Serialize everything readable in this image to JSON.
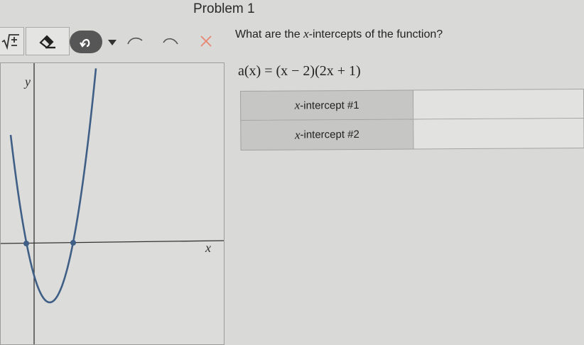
{
  "problem_title": "Problem 1",
  "toolbar": {
    "math_keyboard_icon": "sqrt-plus-minus-icon",
    "eraser_icon": "eraser-icon",
    "undo_icon": "undo-icon",
    "dropdown_icon": "caret-down-icon",
    "curve_left_icon": "curve-icon",
    "curve_right_icon": "curve-icon",
    "close_icon": "close-icon",
    "close_color": "#e8826b"
  },
  "question": {
    "prefix": "What are the",
    "variable": "x",
    "suffix": "-intercepts of the function?"
  },
  "function": {
    "expression": "a(x) = (x − 2)(2x + 1)"
  },
  "graph": {
    "y_label": "y",
    "x_label": "x",
    "curve_color": "#3f5f86"
  },
  "answer_table": {
    "rows": [
      {
        "variable": "x",
        "label": "-intercept #1",
        "value": ""
      },
      {
        "variable": "x",
        "label": "-intercept #2",
        "value": ""
      }
    ]
  }
}
